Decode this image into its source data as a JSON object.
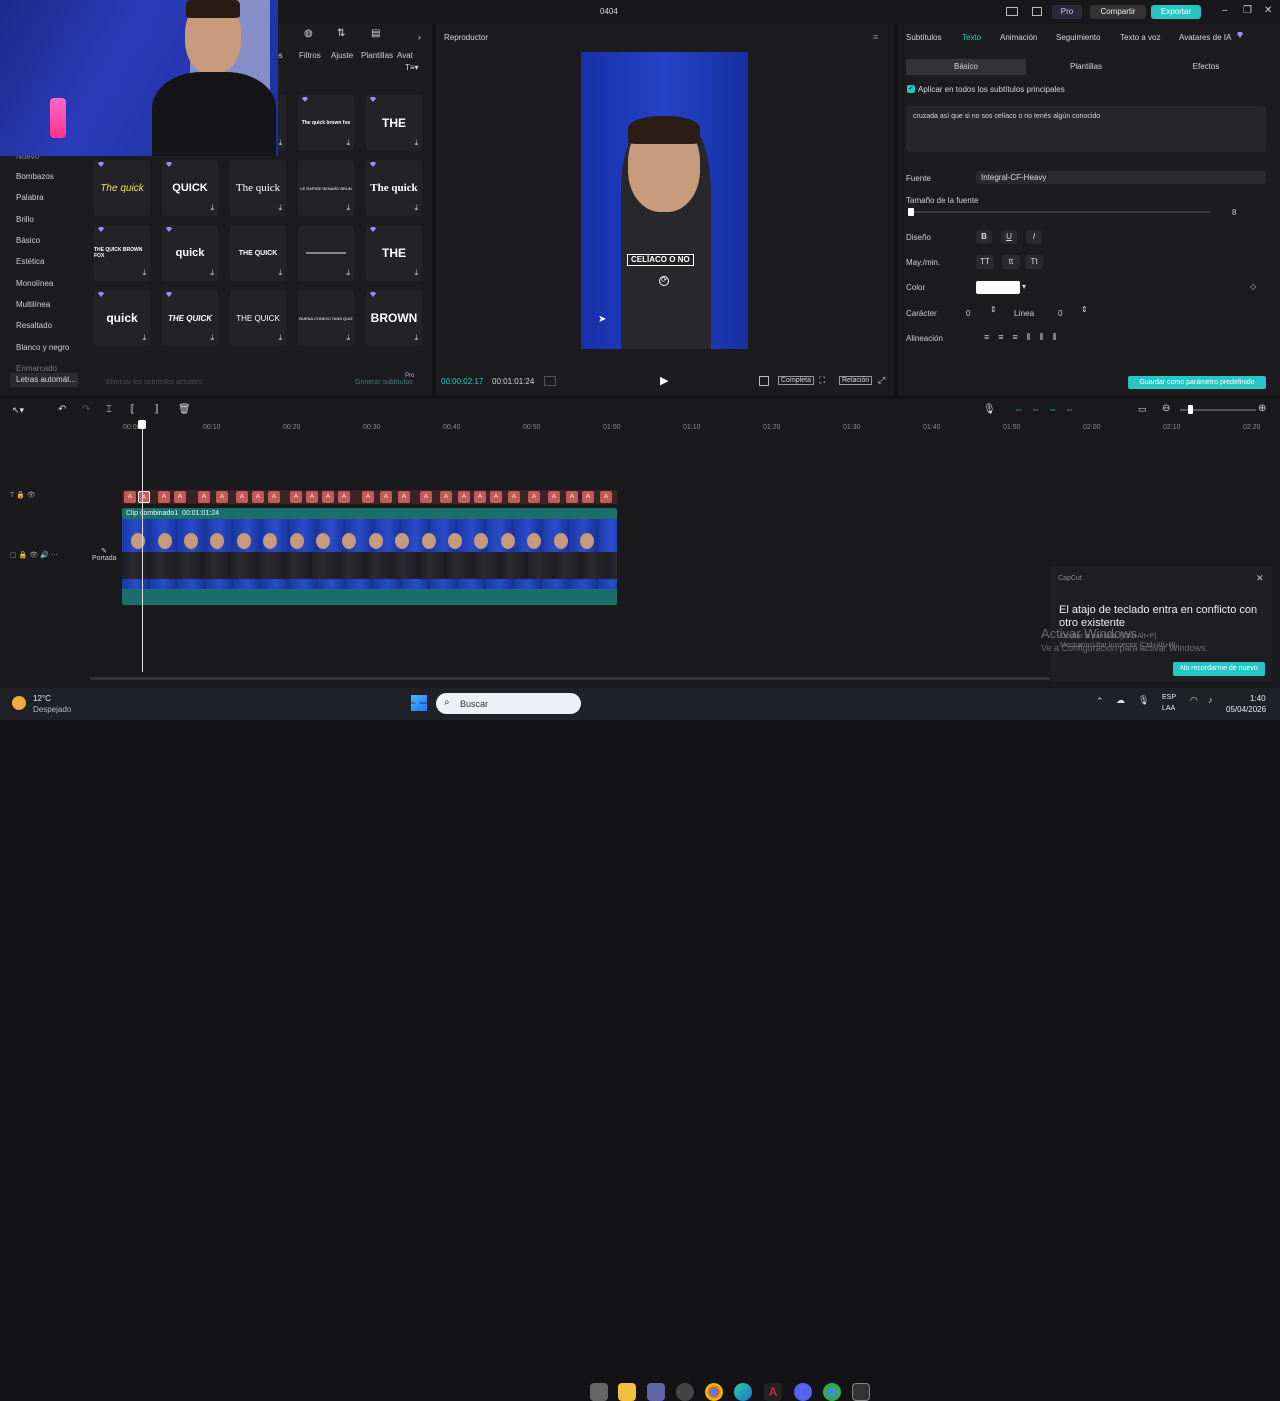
{
  "window": {
    "title": "0404",
    "pro_label": "Pro",
    "share_label": "Compartir",
    "export_label": "Exportar"
  },
  "left_panel": {
    "tabs": [
      "ulos",
      "Filtros",
      "Ajuste",
      "Plantillas",
      "Avat"
    ],
    "categories": [
      "Nuevo",
      "Bombazos",
      "Palabra",
      "Brillo",
      "Básico",
      "Estética",
      "Monolínea",
      "Multilínea",
      "Resaltado",
      "Blanco y negro",
      "Enmarcado",
      "Letras automát..."
    ],
    "tiles": [
      [
        "",
        "The quick brown fox",
        "THE"
      ],
      [
        "The quick",
        "QUICK",
        "The quick",
        "LE RAPIDE RENARD BRUN",
        "The quick"
      ],
      [
        "THE QUICK BROWN FOX",
        "quick",
        "THE QUICK",
        "",
        "THE"
      ],
      [
        "quick",
        "THE QUICK",
        "THE QUICK",
        "BUENA CONEJO TANS QUIZ",
        "BROWN"
      ]
    ],
    "footer_left": "Eliminar los subtítulos actuales",
    "footer_right": "Generar subtítulos",
    "footer_pro": "Pro"
  },
  "player": {
    "title": "Reproductor",
    "caption": "CELÍACO O NO",
    "current_time": "00:00:02:17",
    "total_time": "00:01:01:24",
    "full_label": "Completa",
    "ratio_label": "Relación"
  },
  "right_panel": {
    "tabs": [
      "Subtítulos",
      "Texto",
      "Animación",
      "Seguimiento",
      "Texto a voz",
      "Avatares de IA"
    ],
    "subtabs": [
      "Básico",
      "Plantillas",
      "Efectos"
    ],
    "apply_all": "Aplicar en todos los subtítulos principales",
    "text_content": "cruzada así que si no sos celíaco o no tenés algún conocido",
    "font_label": "Fuente",
    "font_value": "Integral-CF-Heavy",
    "size_label": "Tamaño de la fuente",
    "size_value": "8",
    "design_label": "Diseño",
    "design_buttons": [
      "B",
      "U",
      "I"
    ],
    "case_label": "May./min.",
    "case_buttons": [
      "TT",
      "tt",
      "Tt"
    ],
    "color_label": "Color",
    "char_label": "Carácter",
    "char_value": "0",
    "line_label": "Línea",
    "line_value": "0",
    "align_label": "Alineación",
    "save_default": "Guardar como parámetro predefinido"
  },
  "timeline": {
    "ruler": [
      "00:00",
      "00:10",
      "00:20",
      "00:30",
      "00:40",
      "00:50",
      "01:00",
      "01:10",
      "01:20",
      "01:30",
      "01:40",
      "01:50",
      "02:00",
      "02:10",
      "02:20"
    ],
    "clip_label": "Clip combinado1",
    "clip_duration": "00:01:01:24",
    "cover_label": "Portada"
  },
  "toast": {
    "app": "CapCut",
    "message": "El atajo de teclado entra en conflicto con otro existente",
    "button": "No recordarme de nuevo"
  },
  "watermark": {
    "line1": "Activar Windows",
    "line2": "Ve a Configuración para activar Windows.",
    "ghost1": "Ocultar la pantalla: [Ctrl+Alt+P]",
    "ghost2": "Mostrar/ocultar Inspector [Ctrl+Alt+R]"
  },
  "taskbar": {
    "temp": "12°C",
    "weather": "Despejado",
    "search": "Buscar",
    "lang1": "ESP",
    "lang2": "LAA",
    "time": "1:40",
    "date": "05/04/2026"
  }
}
